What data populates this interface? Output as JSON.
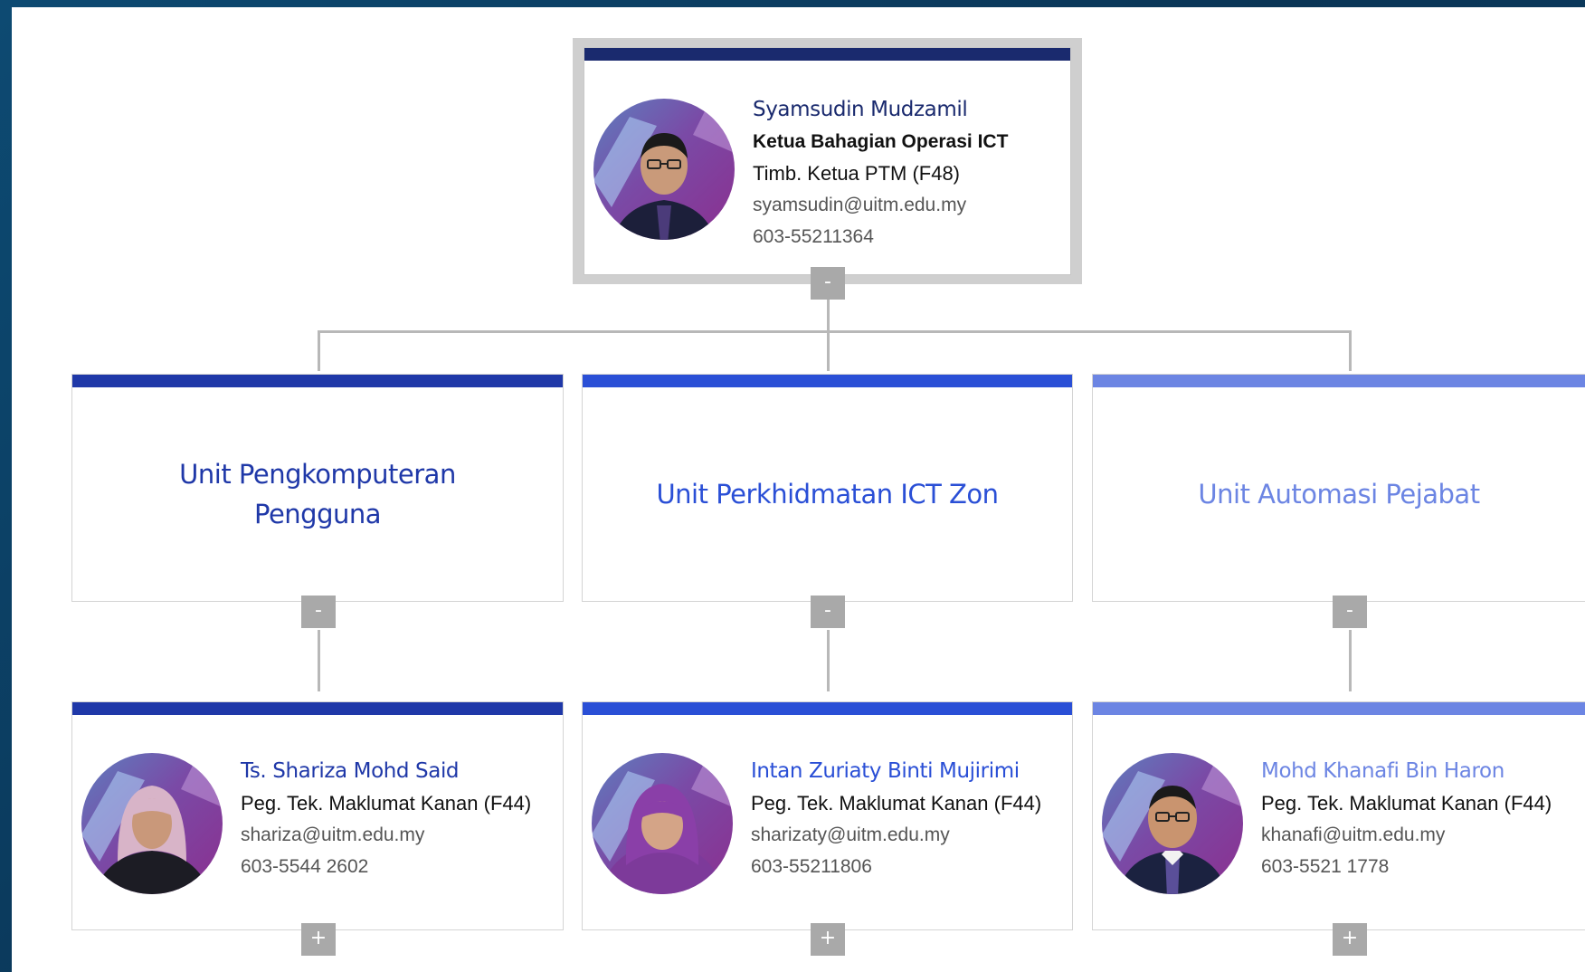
{
  "colors": {
    "frame": "#0b3a5e",
    "level1": "#1f38a8",
    "level2": "#2a4fd6",
    "level3": "#6c85e3",
    "connector": "#b8b8b8",
    "toggle": "#a9a9a9"
  },
  "root": {
    "name": "Syamsudin Mudzamil",
    "title": "Ketua Bahagian Operasi ICT",
    "subtitle": "Timb. Ketua PTM (F48)",
    "email": "syamsudin@uitm.edu.my",
    "phone": "603-55211364",
    "toggle": "-"
  },
  "units": [
    {
      "title": "Unit Pengkomputeran Pengguna",
      "toggle": "-",
      "staff": {
        "name": "Ts. Shariza Mohd Said",
        "title": "Peg. Tek. Maklumat Kanan (F44)",
        "email": "shariza@uitm.edu.my",
        "phone": "603-5544 2602",
        "toggle": "+"
      }
    },
    {
      "title": "Unit Perkhidmatan ICT Zon",
      "toggle": "-",
      "staff": {
        "name": "Intan Zuriaty Binti Mujirimi",
        "title": "Peg. Tek. Maklumat Kanan (F44)",
        "email": "sharizaty@uitm.edu.my",
        "phone": "603-55211806",
        "toggle": "+"
      }
    },
    {
      "title": "Unit Automasi Pejabat",
      "toggle": "-",
      "staff": {
        "name": "Mohd Khanafi Bin Haron",
        "title": "Peg. Tek. Maklumat Kanan (F44)",
        "email": "khanafi@uitm.edu.my",
        "phone": "603-5521 1778",
        "toggle": "+"
      }
    }
  ]
}
